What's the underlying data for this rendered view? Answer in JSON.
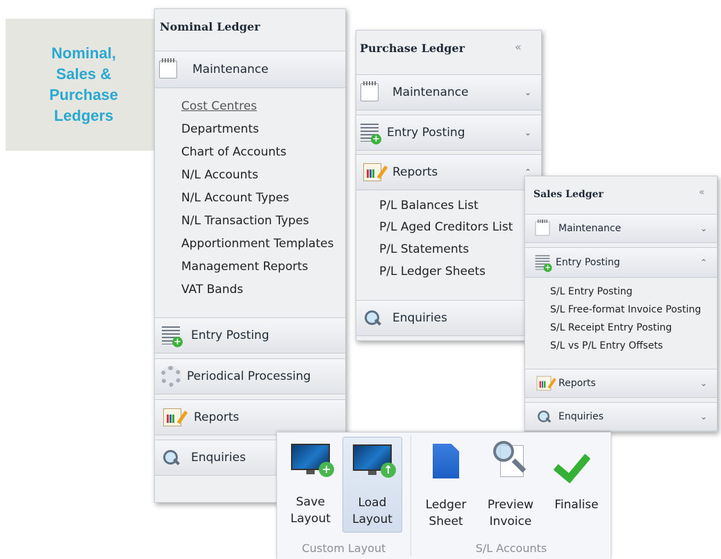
{
  "callout": {
    "lines": [
      "Nominal,",
      "Sales &",
      "Purchase",
      "Ledgers"
    ]
  },
  "nominal": {
    "title": "Nominal Ledger",
    "maintenance": "Maintenance",
    "items": [
      "Cost Centres",
      "Departments",
      "Chart of Accounts",
      "N/L Accounts",
      "N/L Account Types",
      "N/L Transaction Types",
      "Apportionment Templates",
      "Management Reports",
      "VAT Bands"
    ],
    "entry_posting": "Entry Posting",
    "periodical": "Periodical Processing",
    "reports": "Reports",
    "enquiries": "Enquiries"
  },
  "purchase": {
    "title": "Purchase Ledger",
    "collapse": "«",
    "maintenance": "Maintenance",
    "entry_posting": "Entry Posting",
    "reports": "Reports",
    "items": [
      "P/L Balances List",
      "P/L Aged Creditors List",
      "P/L Statements",
      "P/L Ledger Sheets"
    ],
    "enquiries": "Enquiries"
  },
  "sales": {
    "title": "Sales Ledger",
    "collapse": "«",
    "maintenance": "Maintenance",
    "entry_posting": "Entry Posting",
    "items": [
      "S/L Entry Posting",
      "S/L Free-format Invoice Posting",
      "S/L Receipt Entry Posting",
      "S/L vs P/L Entry Offsets"
    ],
    "reports": "Reports",
    "enquiries": "Enquiries"
  },
  "chevrons": {
    "down": "⌄",
    "up": "⌃"
  },
  "ribbon": {
    "custom_layout": {
      "label": "Custom Layout",
      "save": [
        "Save",
        "Layout"
      ],
      "load": [
        "Load",
        "Layout"
      ]
    },
    "sl_accounts": {
      "label": "S/L Accounts",
      "ledger_sheet": [
        "Ledger",
        "Sheet"
      ],
      "preview_invoice": [
        "Preview",
        "Invoice"
      ],
      "finalise": "Finalise"
    }
  }
}
